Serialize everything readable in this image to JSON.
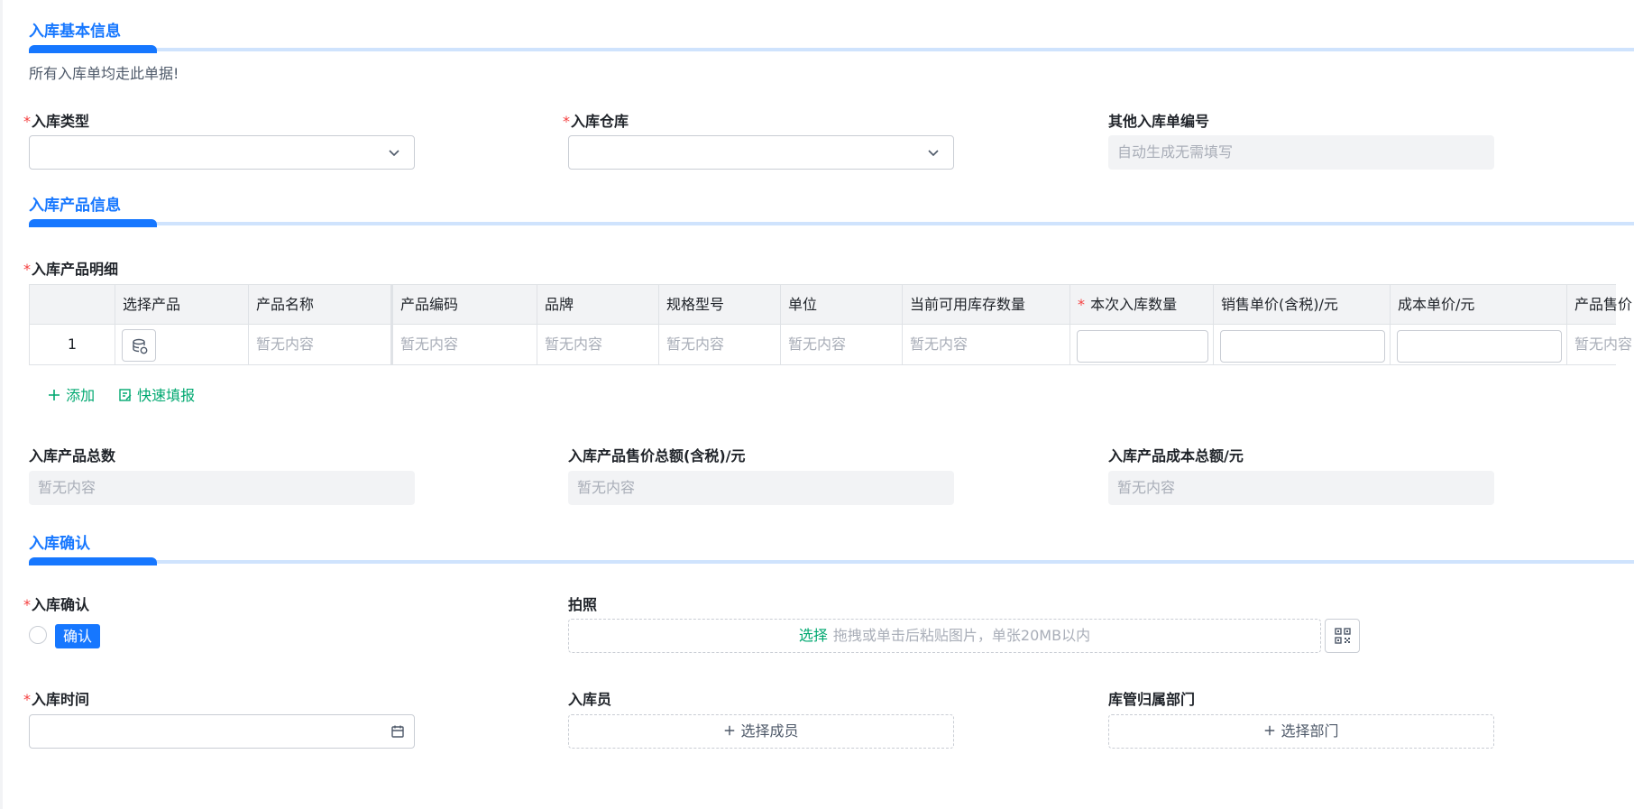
{
  "sections": {
    "basic": {
      "title": "入库基本信息",
      "hint": "所有入库单均走此单据!"
    },
    "product": {
      "title": "入库产品信息"
    },
    "confirm": {
      "title": "入库确认"
    }
  },
  "basic_fields": {
    "type_label": "入库类型",
    "warehouse_label": "入库仓库",
    "order_no_label": "其他入库单编号",
    "order_no_placeholder": "自动生成无需填写"
  },
  "product_detail": {
    "label": "入库产品明细",
    "columns": [
      "",
      "选择产品",
      "产品名称",
      "产品编码",
      "品牌",
      "规格型号",
      "单位",
      "当前可用库存数量",
      "本次入库数量",
      "销售单价(含税)/元",
      "成本单价/元",
      "产品售价"
    ],
    "required_marker": "*",
    "rows": [
      {
        "index": "1",
        "name": "暂无内容",
        "code": "暂无内容",
        "brand": "暂无内容",
        "spec": "暂无内容",
        "unit": "暂无内容",
        "stock": "暂无内容",
        "price_total": "暂无内容"
      }
    ],
    "add_label": "添加",
    "quick_fill_label": "快速填报"
  },
  "totals": {
    "count_label": "入库产品总数",
    "count_value": "暂无内容",
    "sale_label": "入库产品售价总额(含税)/元",
    "sale_value": "暂无内容",
    "cost_label": "入库产品成本总额/元",
    "cost_value": "暂无内容"
  },
  "confirm_fields": {
    "confirm_label": "入库确认",
    "confirm_tag": "确认",
    "photo_label": "拍照",
    "upload_select": "选择",
    "upload_hint": "拖拽或单击后粘贴图片，单张20MB以内",
    "time_label": "入库时间",
    "staff_label": "入库员",
    "staff_button": "选择成员",
    "dept_label": "库管归属部门",
    "dept_button": "选择部门"
  },
  "required_marker": "*",
  "colors": {
    "accent": "#1677ff",
    "success": "#00a870",
    "required": "#f53f3f"
  },
  "icons": [
    "chevron-down-icon",
    "product-picker-icon",
    "plus-icon",
    "quick-fill-icon",
    "qr-code-icon",
    "calendar-icon"
  ]
}
